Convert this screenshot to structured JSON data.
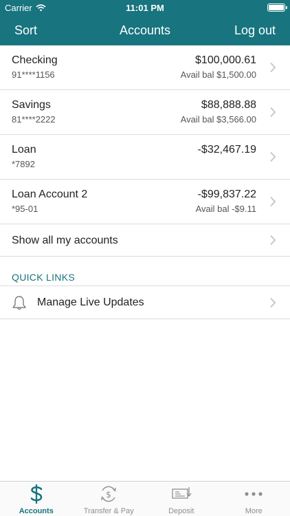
{
  "status_bar": {
    "carrier": "Carrier",
    "time": "11:01 PM"
  },
  "nav": {
    "left": "Sort",
    "title": "Accounts",
    "right": "Log out"
  },
  "accounts": [
    {
      "name": "Checking",
      "number": "91****1156",
      "balance": "$100,000.61",
      "available": "Avail bal $1,500.00"
    },
    {
      "name": "Savings",
      "number": "81****2222",
      "balance": "$88,888.88",
      "available": "Avail bal $3,566.00"
    },
    {
      "name": "Loan",
      "number": "*7892",
      "balance": "-$32,467.19",
      "available": ""
    },
    {
      "name": "Loan Account 2",
      "number": "*95-01",
      "balance": "-$99,837.22",
      "available": "Avail bal -$9.11"
    }
  ],
  "show_all": "Show all my accounts",
  "quick_links": {
    "header": "QUICK LINKS",
    "items": [
      {
        "label": "Manage Live Updates",
        "icon": "bell-icon"
      }
    ]
  },
  "tabs": [
    {
      "label": "Accounts",
      "icon": "dollar-icon",
      "active": true
    },
    {
      "label": "Transfer & Pay",
      "icon": "transfer-icon",
      "active": false
    },
    {
      "label": "Deposit",
      "icon": "check-deposit-icon",
      "active": false
    },
    {
      "label": "More",
      "icon": "more-dots-icon",
      "active": false
    }
  ],
  "colors": {
    "brand": "#18747e",
    "tab_inactive": "#8e8e8e",
    "divider": "#dcdcdc"
  }
}
